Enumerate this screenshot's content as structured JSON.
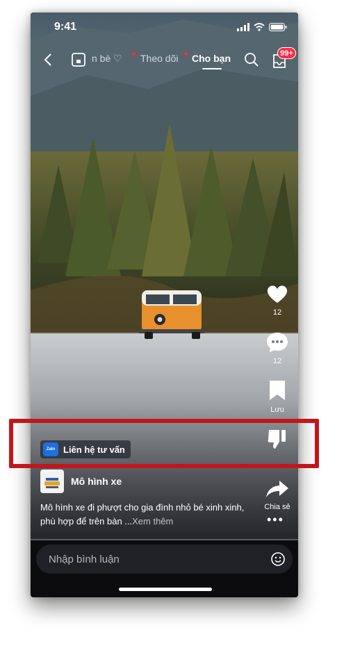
{
  "status_bar": {
    "time": "9:41"
  },
  "top_nav": {
    "tabs": [
      {
        "label": "n bè ♡",
        "active": false,
        "has_dot": true
      },
      {
        "label": "Theo dõi",
        "active": false,
        "has_dot": true
      },
      {
        "label": "Cho bạn",
        "active": true,
        "has_dot": false
      }
    ],
    "notification_badge": "99+"
  },
  "side_actions": {
    "like_count": "12",
    "comment_count": "12",
    "save_label": "Lưu",
    "share_label": "Chia sẻ",
    "more_label": "•••"
  },
  "cta": {
    "logo_text": "Zalo",
    "label": "Liên hệ tư vấn"
  },
  "post": {
    "shop_name": "Mô hình xe",
    "caption": "Mô hình xe đi phượt cho gia đình nhỏ bé xinh xinh, phù hợp để trên bàn ...",
    "see_more": "Xem thêm"
  },
  "comment": {
    "placeholder": "Nhập bình luận"
  },
  "colors": {
    "accent_red": "#ff2a44",
    "highlight_red": "#c2161c",
    "zalo_blue": "#1e6fe0"
  },
  "icons": [
    "back-icon",
    "library-icon",
    "search-icon",
    "inbox-icon",
    "heart-icon",
    "comment-icon",
    "bookmark-icon",
    "dislike-icon",
    "share-icon",
    "more-icon",
    "emoji-icon"
  ]
}
